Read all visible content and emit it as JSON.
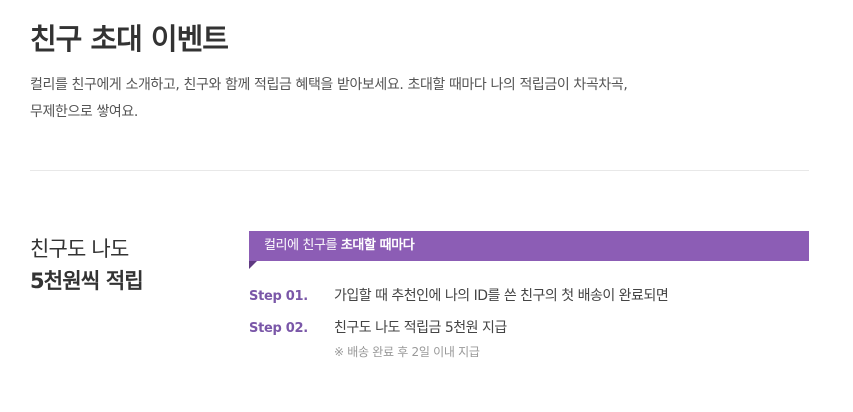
{
  "event": {
    "title": "친구 초대 이벤트",
    "intro_line1": "컬리를 친구에게 소개하고, 친구와 함께 적립금 혜택을 받아보세요. 초대할 때마다 나의 적립금이 차곡차곡,",
    "intro_line2": "무제한으로 쌓여요."
  },
  "reward": {
    "heading_line1": "친구도 나도",
    "heading_line2": "5천원씩 적립"
  },
  "banner": {
    "prefix": "컬리에 친구를 ",
    "emphasis": "초대할 때마다"
  },
  "steps": [
    {
      "label": "Step 01.",
      "text": "가입할 때 추천인에 나의 ID를 쓴 친구의 첫 배송이 완료되면"
    },
    {
      "label": "Step 02.",
      "text": "친구도 나도 적립금 5천원 지급",
      "note": "※ 배송 완료 후 2일 이내 지급"
    }
  ],
  "colors": {
    "accent": "#8c5db5",
    "accent_dark": "#5f3a82",
    "step_label": "#7a57a8",
    "text": "#333333",
    "note": "#999999"
  }
}
